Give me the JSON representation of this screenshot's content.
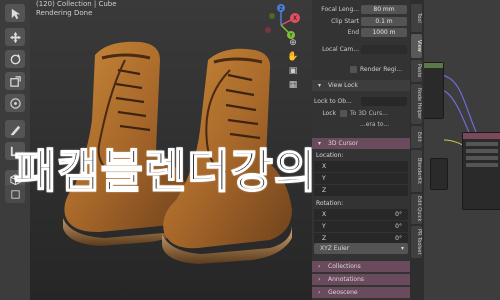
{
  "viewport": {
    "header_line1": "(120) Collection | Cube",
    "header_line2": "Rendering Done"
  },
  "overlay_title": "패캠블렌더강의",
  "gizmo": {
    "x": "X",
    "y": "Y",
    "z": "Z"
  },
  "properties": {
    "focal_length_label": "Focal Leng...",
    "focal_length_value": "80 mm",
    "clip_start_label": "Clip Start",
    "clip_start_value": "0.1 m",
    "clip_end_label": "End",
    "clip_end_value": "1000 m",
    "local_camera_label": "Local Cam...",
    "render_region_label": "Render Regi...",
    "view_lock_header": "View Lock",
    "lock_to_object_label": "Lock to Ob...",
    "lock_label": "Lock",
    "to_3d_cursor_label": "To 3D Curs...",
    "camera_label": "...era to...",
    "cursor_header": "3D Cursor",
    "location_label": "Location:",
    "loc_x_label": "X",
    "loc_y_label": "Y",
    "loc_z_label": "Z",
    "rotation_label": "Rotation:",
    "rot_x_label": "X",
    "rot_x_value": "0°",
    "rot_y_label": "Y",
    "rot_y_value": "0°",
    "rot_z_label": "Z",
    "rot_z_value": "0°",
    "rotation_mode": "XYZ Euler",
    "collections_header": "Collections",
    "annotations_header": "Annotations",
    "geoscene_header": "Geoscene"
  },
  "side_tabs": [
    "Tool",
    "View",
    "Paste",
    "Node Helper",
    "Edit",
    "BlenderKit",
    "Edit Quick",
    "PR Toolset"
  ],
  "colors": {
    "accent_blue": "#5a7fb3",
    "section_pink": "#6a4a5d",
    "panel_bg": "#333333"
  }
}
